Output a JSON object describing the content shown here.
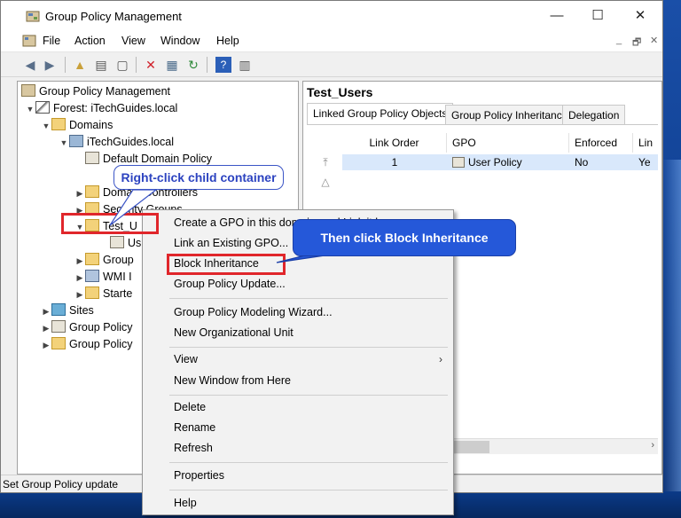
{
  "window": {
    "title": "Group Policy Management",
    "controls": {
      "minimize": "—",
      "maximize": "☐",
      "close": "✕"
    }
  },
  "menubar": {
    "items": [
      "File",
      "Action",
      "View",
      "Window",
      "Help"
    ],
    "child_controls": [
      "_",
      "🗗",
      "✕"
    ]
  },
  "toolbar": {
    "icons": [
      "back-icon",
      "forward-icon",
      "up-folder-icon",
      "show-hide-tree-icon",
      "properties-icon",
      "delete-icon",
      "export-icon",
      "refresh-icon",
      "help-icon",
      "console-icon"
    ]
  },
  "tree": {
    "items": [
      {
        "label": "Group Policy Management",
        "icon": "gpm"
      },
      {
        "label": "Forest: iTechGuides.local",
        "icon": "forest"
      },
      {
        "label": "Domains",
        "icon": "folder"
      },
      {
        "label": "iTechGuides.local",
        "icon": "domain"
      },
      {
        "label": "Default Domain Policy",
        "icon": "gpo"
      },
      {
        "label": "Domain Controllers",
        "icon": "folder"
      },
      {
        "label": "Security Groups",
        "icon": "folder"
      },
      {
        "label": "Test_U",
        "icon": "folder"
      },
      {
        "label": "Us",
        "icon": "gpo"
      },
      {
        "label": "Group",
        "icon": "folder"
      },
      {
        "label": "WMI I",
        "icon": "wmi"
      },
      {
        "label": "Starte",
        "icon": "folder"
      },
      {
        "label": "Sites",
        "icon": "site"
      },
      {
        "label": "Group Policy",
        "icon": "gpo"
      },
      {
        "label": "Group Policy",
        "icon": "folder"
      }
    ]
  },
  "right_pane": {
    "title": "Test_Users",
    "tabs": [
      "Linked Group Policy Objects",
      "Group Policy Inheritance",
      "Delegation"
    ],
    "columns": [
      "Link Order",
      "GPO",
      "Enforced",
      "Lin"
    ],
    "rows": [
      {
        "link_order": "1",
        "gpo": "User Policy",
        "enforced": "No",
        "link_enabled": "Ye"
      }
    ]
  },
  "context_menu": {
    "items": [
      "Create a GPO in this domain, and Link it here...",
      "Link an Existing GPO...",
      "Block Inheritance",
      "Group Policy Update...",
      "Group Policy Modeling Wizard...",
      "New Organizational Unit",
      "View",
      "New Window from Here",
      "Delete",
      "Rename",
      "Refresh",
      "Properties",
      "Help"
    ]
  },
  "callouts": {
    "first": "Right-click child container",
    "second": "Then click Block Inheritance"
  },
  "status": {
    "text": "Set Group Policy update"
  },
  "colors": {
    "highlight": "#e0262b",
    "callout_border": "#3b55c6",
    "callout_fill_second": "#2558d9",
    "selection_row": "#d9e8fb"
  }
}
